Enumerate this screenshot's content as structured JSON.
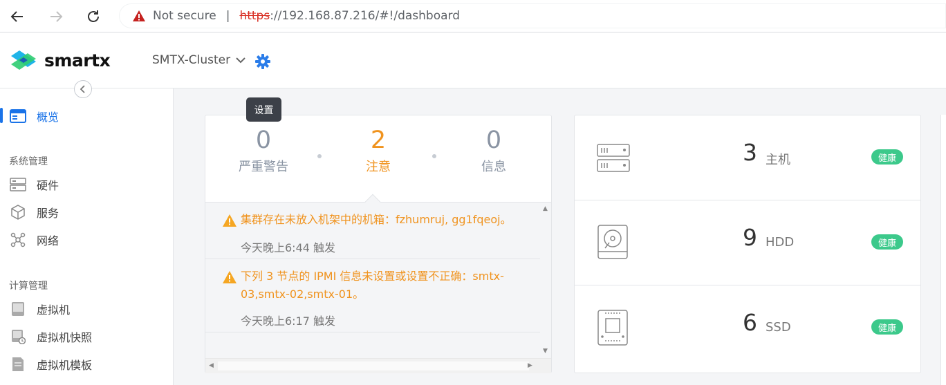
{
  "browser": {
    "security_label": "Not secure",
    "url_scheme": "https",
    "url_rest": "://192.168.87.216/#!/dashboard"
  },
  "header": {
    "logo_text": "smartx",
    "cluster_name": "SMTX-Cluster",
    "settings_icon": "gear-icon"
  },
  "tooltip": {
    "text": "设置"
  },
  "sidebar": {
    "overview": "概览",
    "sections": [
      {
        "title": "系统管理",
        "items": [
          "硬件",
          "服务",
          "网络"
        ]
      },
      {
        "title": "计算管理",
        "items": [
          "虚拟机",
          "虚拟机快照",
          "虚拟机模板"
        ]
      }
    ]
  },
  "alerts": {
    "counts": [
      {
        "value": "0",
        "label": "严重警告"
      },
      {
        "value": "2",
        "label": "注意"
      },
      {
        "value": "0",
        "label": "信息"
      }
    ],
    "items": [
      {
        "message": "集群存在未放入机架中的机箱：fzhumruj, gg1fqeoj。",
        "time": "今天晚上6:44 触发"
      },
      {
        "message": "下列 3 节点的 IPMI 信息未设置或设置不正确：smtx-03,smtx-02,smtx-01。",
        "time": "今天晚上6:17 触发"
      }
    ]
  },
  "resources": [
    {
      "value": "3",
      "label": "主机",
      "status": "健康",
      "icon": "server-icon"
    },
    {
      "value": "9",
      "label": "HDD",
      "status": "健康",
      "icon": "hdd-icon"
    },
    {
      "value": "6",
      "label": "SSD",
      "status": "健康",
      "icon": "ssd-icon"
    }
  ],
  "colors": {
    "accent": "#1a73e8",
    "warning": "#f0931e",
    "healthy": "#3cc98b"
  }
}
